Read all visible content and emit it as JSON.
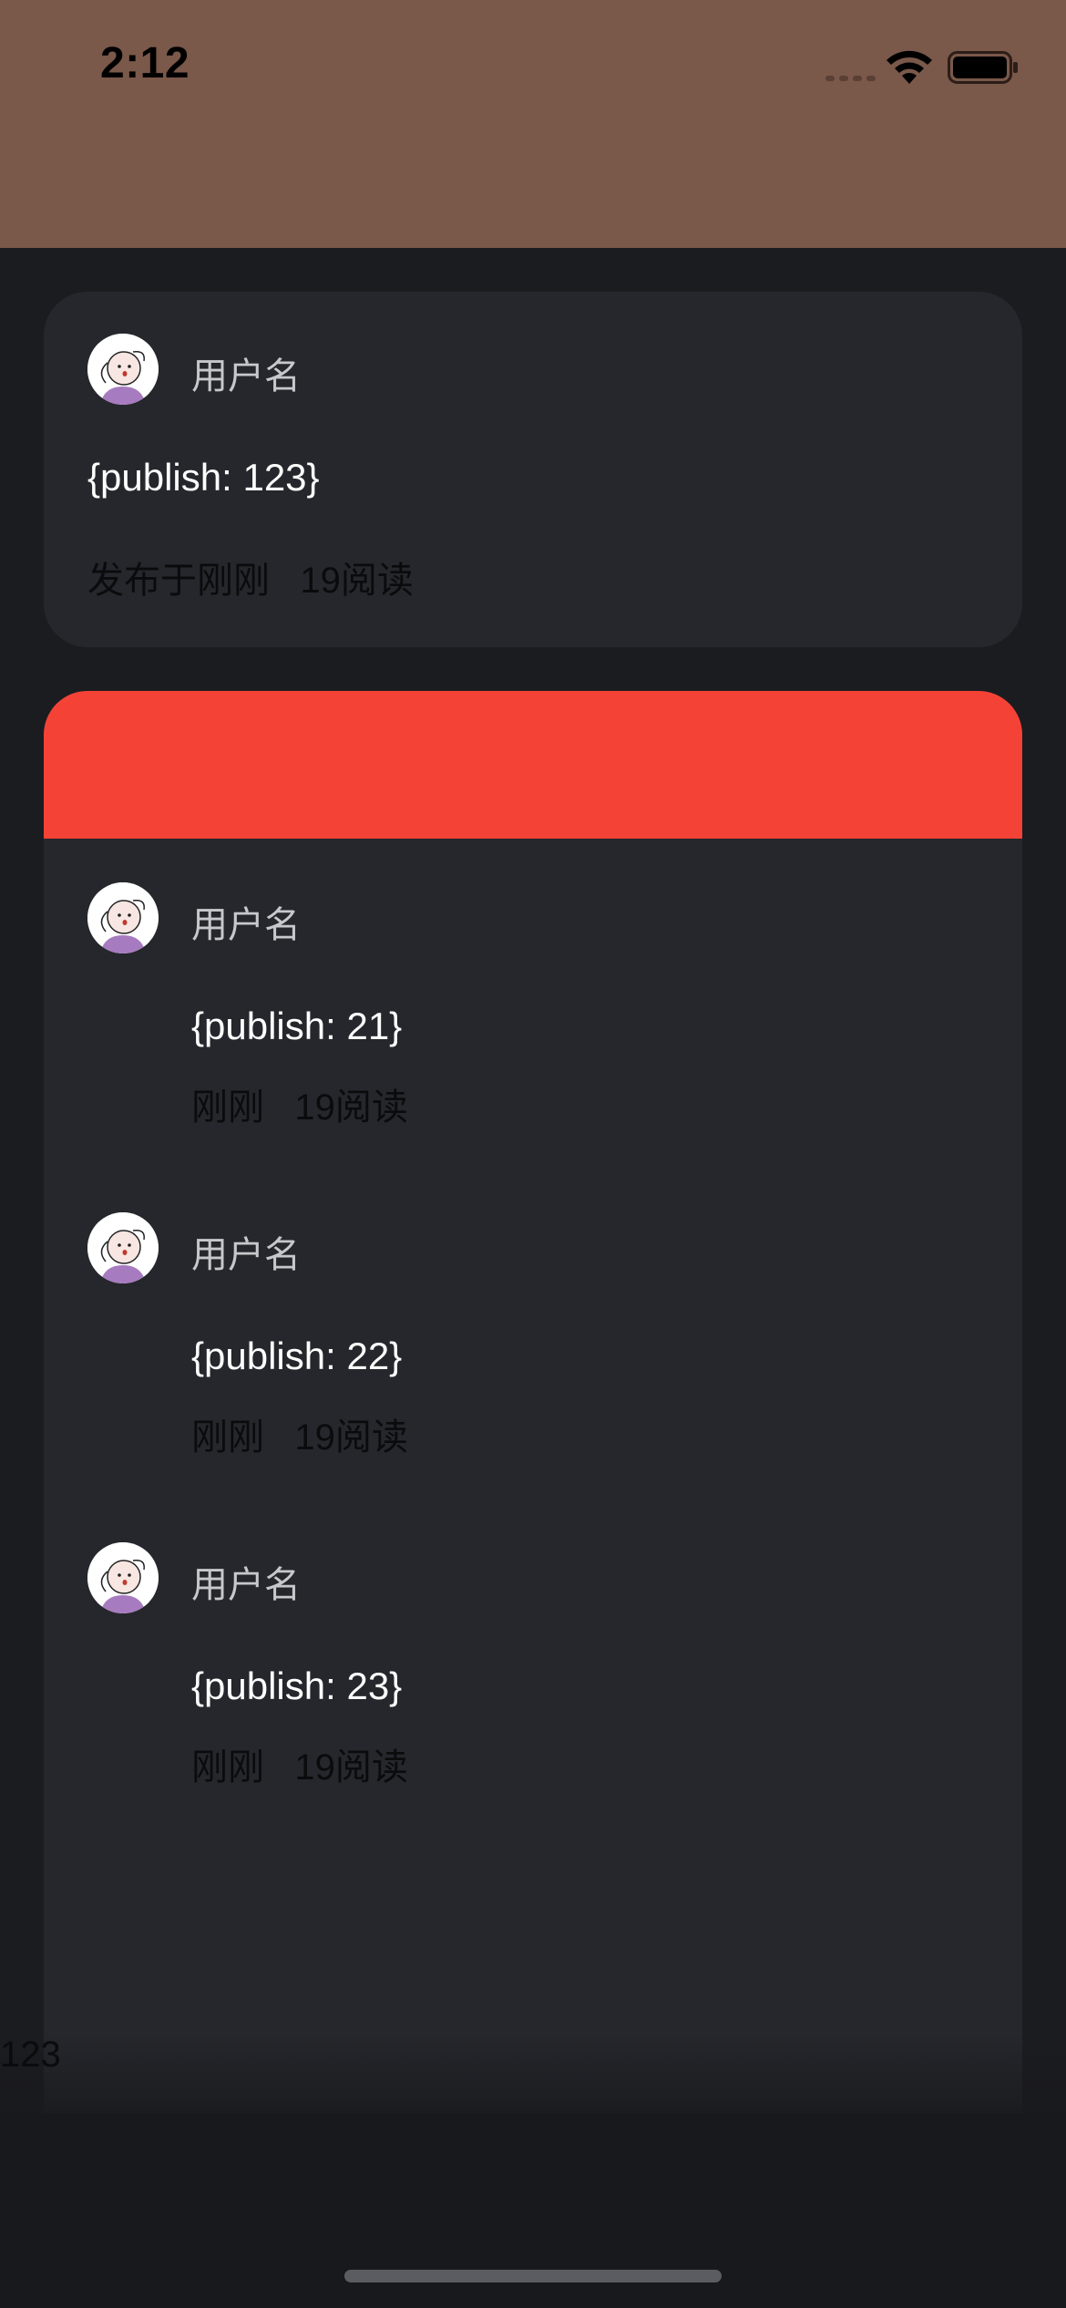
{
  "status_bar": {
    "time": "2:12",
    "background": "#7a584a"
  },
  "top_post": {
    "username": "用户名",
    "content": "{publish: 123}",
    "meta": "发布于刚刚   19阅读"
  },
  "comments": [
    {
      "username": "用户名",
      "content": "{publish: 21}",
      "meta": "刚刚   19阅读"
    },
    {
      "username": "用户名",
      "content": "{publish: 22}",
      "meta": "刚刚   19阅读"
    },
    {
      "username": "用户名",
      "content": "{publish: 23}",
      "meta": "刚刚   19阅读"
    }
  ],
  "bottom_label": "123",
  "colors": {
    "page_background": "#1b1c20",
    "card_background": "#26272c",
    "banner": "#f44336",
    "username": "#c8c8cc",
    "content": "#ffffff",
    "meta": "#0b0b0d"
  }
}
